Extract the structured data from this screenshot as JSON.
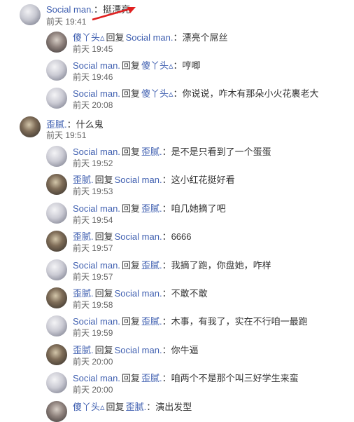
{
  "top_comment": {
    "user": "Social man.",
    "sep": "：",
    "text": "挺漂亮",
    "time": "前天 19:41"
  },
  "reply_word": "回复",
  "thread1": [
    {
      "user": "傻丫头",
      "user_suffix": "▵",
      "to": "Social man.",
      "to_suffix": "",
      "text": "漂亮个屌丝",
      "time": "前天 19:45",
      "avatar": "shaya"
    },
    {
      "user": "Social man.",
      "user_suffix": "",
      "to": "傻丫头",
      "to_suffix": "▵",
      "text": "哼唧",
      "time": "前天 19:46",
      "avatar": "social"
    },
    {
      "user": "Social man.",
      "user_suffix": "",
      "to": "傻丫头",
      "to_suffix": "▵",
      "text": "你说说，咋木有那朵小火花裹老大",
      "time": "前天 20:08",
      "avatar": "social"
    }
  ],
  "second_comment": {
    "user": "歪腻.",
    "sep": "：",
    "text": "什么鬼",
    "time": "前天 19:51"
  },
  "thread2": [
    {
      "user": "Social man.",
      "user_suffix": "",
      "to": "歪腻.",
      "to_suffix": "",
      "text": "是不是只看到了一个蛋蛋",
      "time": "前天 19:52",
      "avatar": "social"
    },
    {
      "user": "歪腻.",
      "user_suffix": "",
      "to": "Social man.",
      "to_suffix": "",
      "text": "这小红花挺好看",
      "time": "前天 19:53",
      "avatar": "waini"
    },
    {
      "user": "Social man.",
      "user_suffix": "",
      "to": "歪腻.",
      "to_suffix": "",
      "text": "咱几她摘了吧",
      "time": "前天 19:54",
      "avatar": "social"
    },
    {
      "user": "歪腻.",
      "user_suffix": "",
      "to": "Social man.",
      "to_suffix": "",
      "text": "6666",
      "time": "前天 19:57",
      "avatar": "waini"
    },
    {
      "user": "Social man.",
      "user_suffix": "",
      "to": "歪腻.",
      "to_suffix": "",
      "text": "我摘了跑，你盘她，咋样",
      "time": "前天 19:57",
      "avatar": "social"
    },
    {
      "user": "歪腻.",
      "user_suffix": "",
      "to": "Social man.",
      "to_suffix": "",
      "text": "不敢不敢",
      "time": "前天 19:58",
      "avatar": "waini"
    },
    {
      "user": "Social man.",
      "user_suffix": "",
      "to": "歪腻.",
      "to_suffix": "",
      "text": "木事，有我了，实在不行咱一最跑",
      "time": "前天 19:59",
      "avatar": "social"
    },
    {
      "user": "歪腻.",
      "user_suffix": "",
      "to": "Social man.",
      "to_suffix": "",
      "text": "你牛逼",
      "time": "前天 20:00",
      "avatar": "waini"
    },
    {
      "user": "Social man.",
      "user_suffix": "",
      "to": "歪腻.",
      "to_suffix": "",
      "text": "咱两个不是那个叫三好学生来蛮",
      "time": "前天 20:00",
      "avatar": "social"
    },
    {
      "user": "傻丫头",
      "user_suffix": "▵",
      "to": "歪腻.",
      "to_suffix": "",
      "text": "演出发型",
      "time": "",
      "avatar": "shaya"
    }
  ]
}
